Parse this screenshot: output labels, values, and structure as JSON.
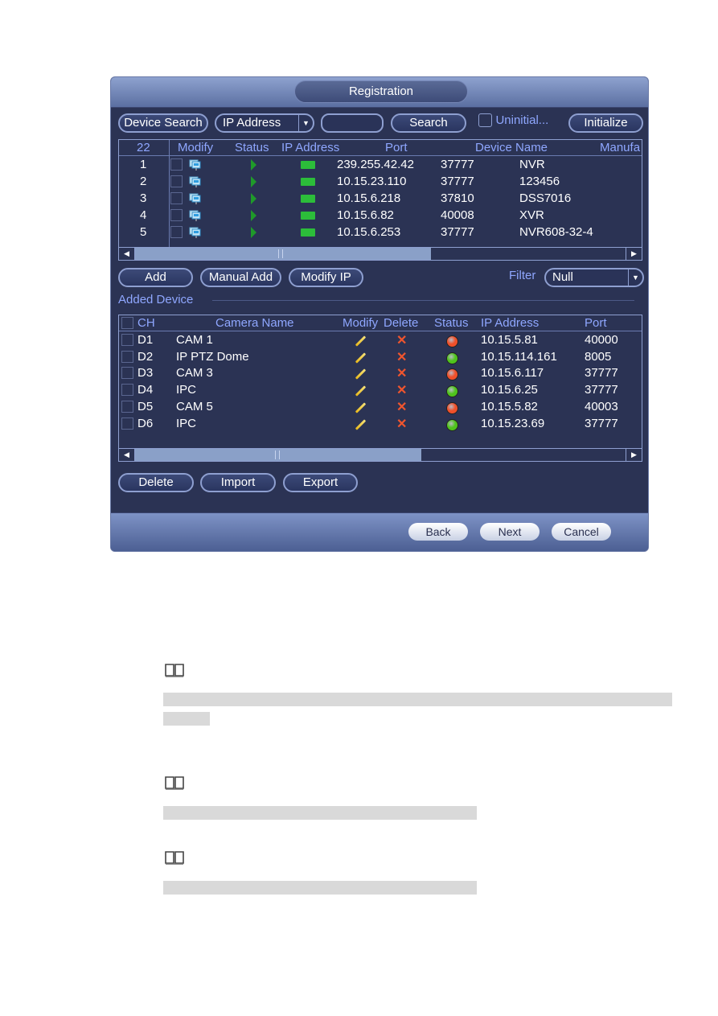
{
  "window": {
    "title": "Registration"
  },
  "toolbar": {
    "device_search_label": "Device Search",
    "search_type": "IP Address",
    "search_text": "",
    "search_label": "Search",
    "uninitialized_label": "Uninitial...",
    "uninitialized_checked": false,
    "initialize_label": "Initialize"
  },
  "search_table": {
    "count": "22",
    "columns": [
      "Modify",
      "Status",
      "IP Address",
      "Port",
      "Device Name",
      "Manufa"
    ],
    "rows": [
      {
        "no": "1",
        "ip": "239.255.42.42",
        "port": "37777",
        "name": "NVR"
      },
      {
        "no": "2",
        "ip": "10.15.23.110",
        "port": "37777",
        "name": "123456"
      },
      {
        "no": "3",
        "ip": "10.15.6.218",
        "port": "37810",
        "name": "DSS7016"
      },
      {
        "no": "4",
        "ip": "10.15.6.82",
        "port": "40008",
        "name": "XVR"
      },
      {
        "no": "5",
        "ip": "10.15.6.253",
        "port": "37777",
        "name": "NVR608-32-4"
      }
    ],
    "scroll_position": 0.0,
    "scroll_visible_fraction": 0.6
  },
  "actions": {
    "add_label": "Add",
    "manual_add_label": "Manual Add",
    "modify_ip_label": "Modify IP",
    "filter_label": "Filter",
    "filter_value": "Null"
  },
  "added_device": {
    "section_label": "Added Device",
    "columns": [
      "CH",
      "Camera Name",
      "Modify",
      "Delete",
      "Status",
      "IP Address",
      "Port"
    ],
    "rows": [
      {
        "ch": "D1",
        "name": "CAM 1",
        "status": "offline",
        "ip": "10.15.5.81",
        "port": "40000"
      },
      {
        "ch": "D2",
        "name": "IP PTZ Dome",
        "status": "online",
        "ip": "10.15.114.161",
        "port": "8005"
      },
      {
        "ch": "D3",
        "name": "CAM 3",
        "status": "offline",
        "ip": "10.15.6.117",
        "port": "37777"
      },
      {
        "ch": "D4",
        "name": "IPC",
        "status": "online",
        "ip": "10.15.6.25",
        "port": "37777"
      },
      {
        "ch": "D5",
        "name": "CAM 5",
        "status": "offline",
        "ip": "10.15.5.82",
        "port": "40003"
      },
      {
        "ch": "D6",
        "name": "IPC",
        "status": "online",
        "ip": "10.15.23.69",
        "port": "37777"
      }
    ],
    "status_colors": {
      "online": "#4fc41c",
      "offline": "#f0502a"
    },
    "scroll_position": 0.0,
    "scroll_visible_fraction": 0.57
  },
  "bottom_actions": {
    "delete_label": "Delete",
    "import_label": "Import",
    "export_label": "Export"
  },
  "footer": {
    "back_label": "Back",
    "next_label": "Next",
    "cancel_label": "Cancel"
  },
  "notes": [
    {
      "icon": "book-icon"
    },
    {
      "icon": "book-icon"
    },
    {
      "icon": "book-icon"
    }
  ]
}
